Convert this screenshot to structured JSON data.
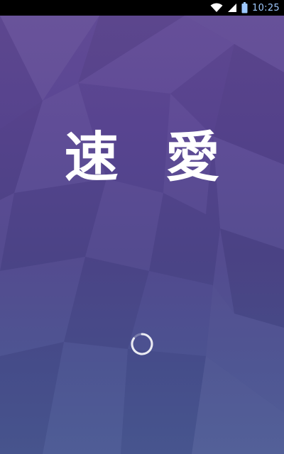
{
  "status_bar": {
    "time": "10:25",
    "icons": [
      "wifi-icon",
      "signal-icon",
      "battery-icon"
    ],
    "time_color": "#9ec9ff"
  },
  "splash": {
    "title": "速 愛",
    "loading": true,
    "colors": {
      "top": "#614a95",
      "bottom": "#4a5893"
    }
  }
}
